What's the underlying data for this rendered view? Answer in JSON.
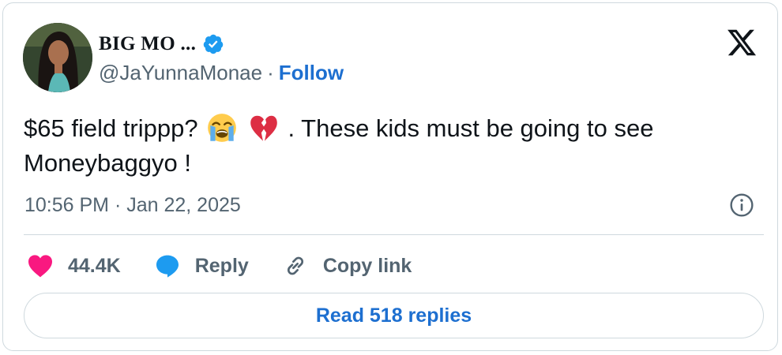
{
  "author": {
    "display_name": "BIG MO ...",
    "handle": "@JaYunnaMonae",
    "separator": "·",
    "follow_label": "Follow"
  },
  "tweet": {
    "text_part1": "$65 field trippp?",
    "text_part2": ". These kids must be going to see Moneybaggyo !",
    "emojis": [
      "loudly-crying-face-emoji",
      "broken-heart-emoji"
    ],
    "timestamp": "10:56 PM · Jan 22, 2025"
  },
  "actions": {
    "like_count": "44.4K",
    "reply_label": "Reply",
    "copy_link_label": "Copy link"
  },
  "read_replies_label": "Read 518 replies",
  "colors": {
    "accent": "#1d6fd0",
    "like": "#f91880",
    "muted": "#536471",
    "border": "#cfd9de"
  }
}
